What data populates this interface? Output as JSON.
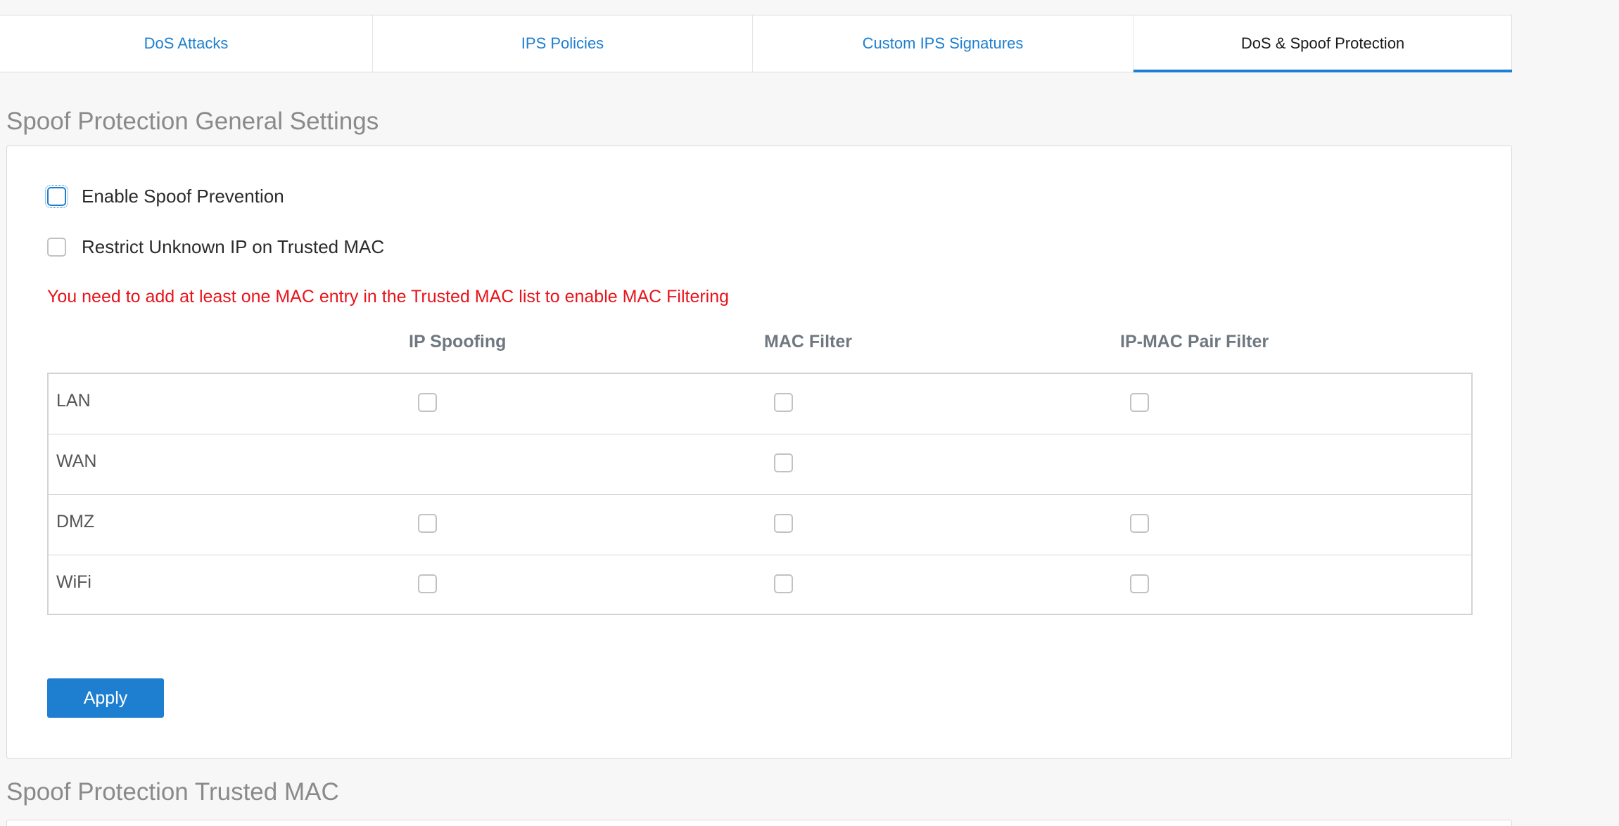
{
  "tabs": [
    {
      "label": "DoS Attacks"
    },
    {
      "label": "IPS Policies"
    },
    {
      "label": "Custom IPS Signatures"
    },
    {
      "label": "DoS & Spoof Protection",
      "active": true
    }
  ],
  "general": {
    "title": "Spoof Protection General Settings",
    "enable_spoof_label": "Enable Spoof Prevention",
    "restrict_unknown_label": "Restrict Unknown IP on Trusted MAC",
    "warning": "You need to add at least one MAC entry in the Trusted MAC list to enable MAC Filtering",
    "columns": [
      "IP Spoofing",
      "MAC Filter",
      "IP-MAC Pair Filter"
    ],
    "rows": [
      {
        "zone": "LAN"
      },
      {
        "zone": "WAN"
      },
      {
        "zone": "DMZ"
      },
      {
        "zone": "WiFi"
      }
    ],
    "apply_label": "Apply"
  },
  "trusted": {
    "title": "Spoof Protection Trusted MAC"
  },
  "colors": {
    "accent": "#1e7fd0",
    "warning": "#e8141b"
  }
}
